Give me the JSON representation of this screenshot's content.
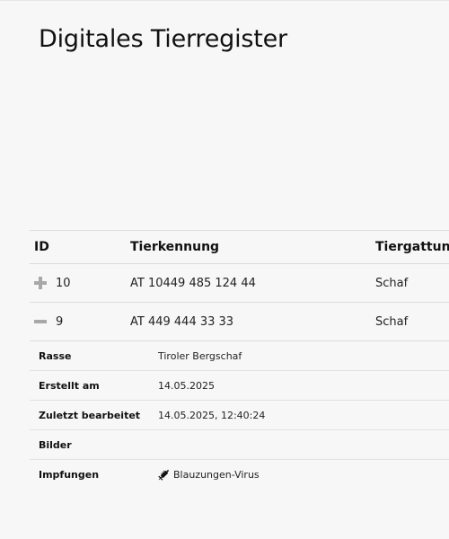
{
  "page": {
    "title": "Digitales Tierregister"
  },
  "table": {
    "columns": {
      "id": "ID",
      "tierkennung": "Tierkennung",
      "tiergattung": "Tiergattung"
    },
    "rows": [
      {
        "id": "10",
        "tierkennung": "AT 10449 485 124 44",
        "tiergattung": "Schaf",
        "expanded": false,
        "toggle_icon": "plus-icon"
      },
      {
        "id": "9",
        "tierkennung": "AT 449 444 33 33",
        "tiergattung": "Schaf",
        "expanded": true,
        "toggle_icon": "minus-icon"
      }
    ]
  },
  "detail": {
    "rasse_label": "Rasse",
    "rasse_value": "Tiroler Bergschaf",
    "erstellt_label": "Erstellt am",
    "erstellt_value": "14.05.2025",
    "bearbeitet_label": "Zuletzt bearbeitet",
    "bearbeitet_value": "14.05.2025, 12:40:24",
    "bilder_label": "Bilder",
    "bilder_value": "",
    "impfungen_label": "Impfungen",
    "impfungen_value": "Blauzungen-Virus",
    "impfungen_icon": "syringe-icon"
  }
}
